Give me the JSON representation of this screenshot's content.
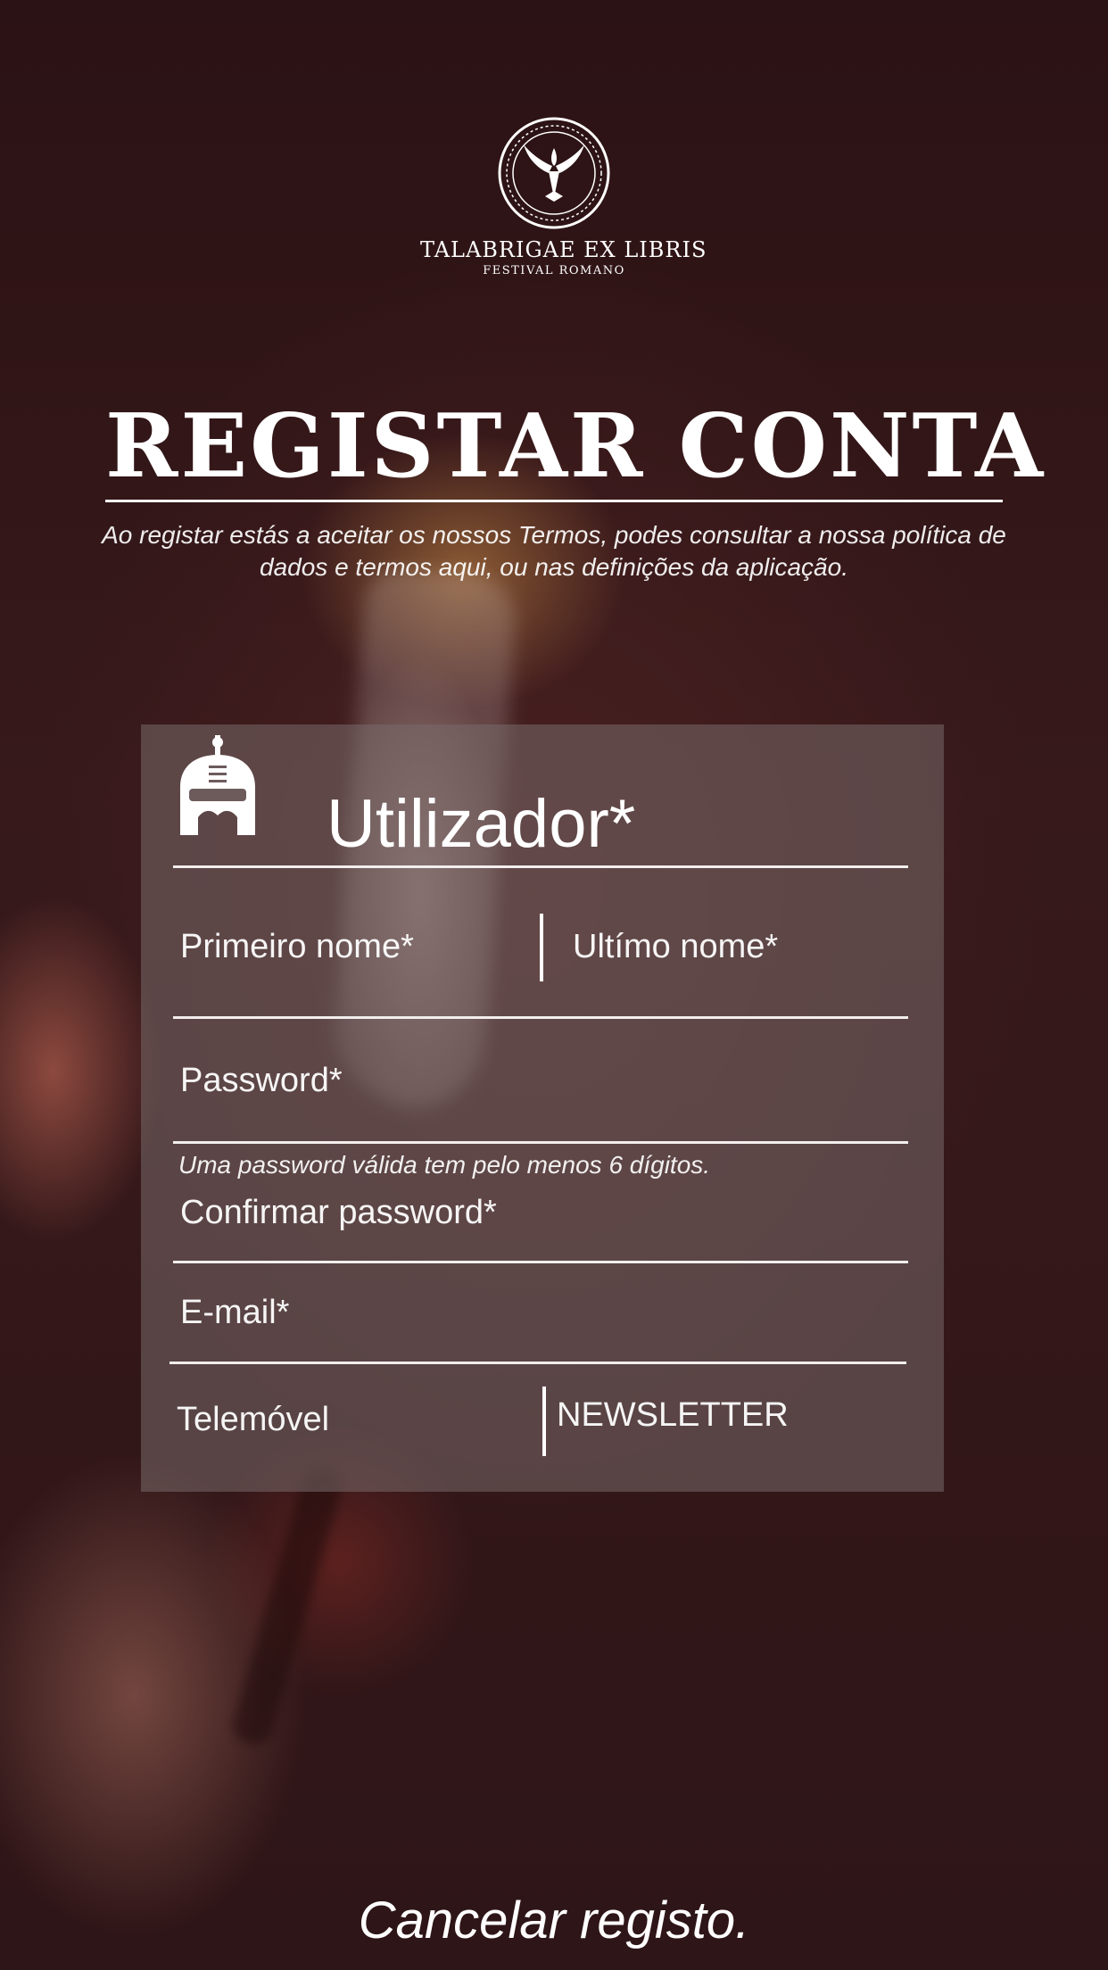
{
  "logo": {
    "title": "TALABRIGAE EX LIBRIS",
    "subtitle": "FESTIVAL ROMANO",
    "emblem_icon": "phoenix-emblem-icon"
  },
  "header": {
    "title": "REGISTAR CONTA",
    "terms_text": "Ao registar estás a aceitar os nossos Termos, podes consultar a nossa política de dados e termos aqui, ou nas definições da aplicação."
  },
  "form": {
    "section_title": "Utilizador*",
    "section_icon": "roman-helmet-icon",
    "first_name_placeholder": "Primeiro nome*",
    "last_name_placeholder": "Ultímo nome*",
    "password_placeholder": "Password*",
    "password_hint": "Uma password válida tem pelo menos 6 dígitos.",
    "confirm_password_placeholder": "Confirmar password*",
    "email_placeholder": "E-mail*",
    "phone_placeholder": "Telemóvel",
    "newsletter_label": "NEWSLETTER"
  },
  "footer": {
    "cancel_label": "Cancelar registo."
  },
  "colors": {
    "background": "#2e1517",
    "card": "#786969",
    "text": "#ffffff"
  }
}
